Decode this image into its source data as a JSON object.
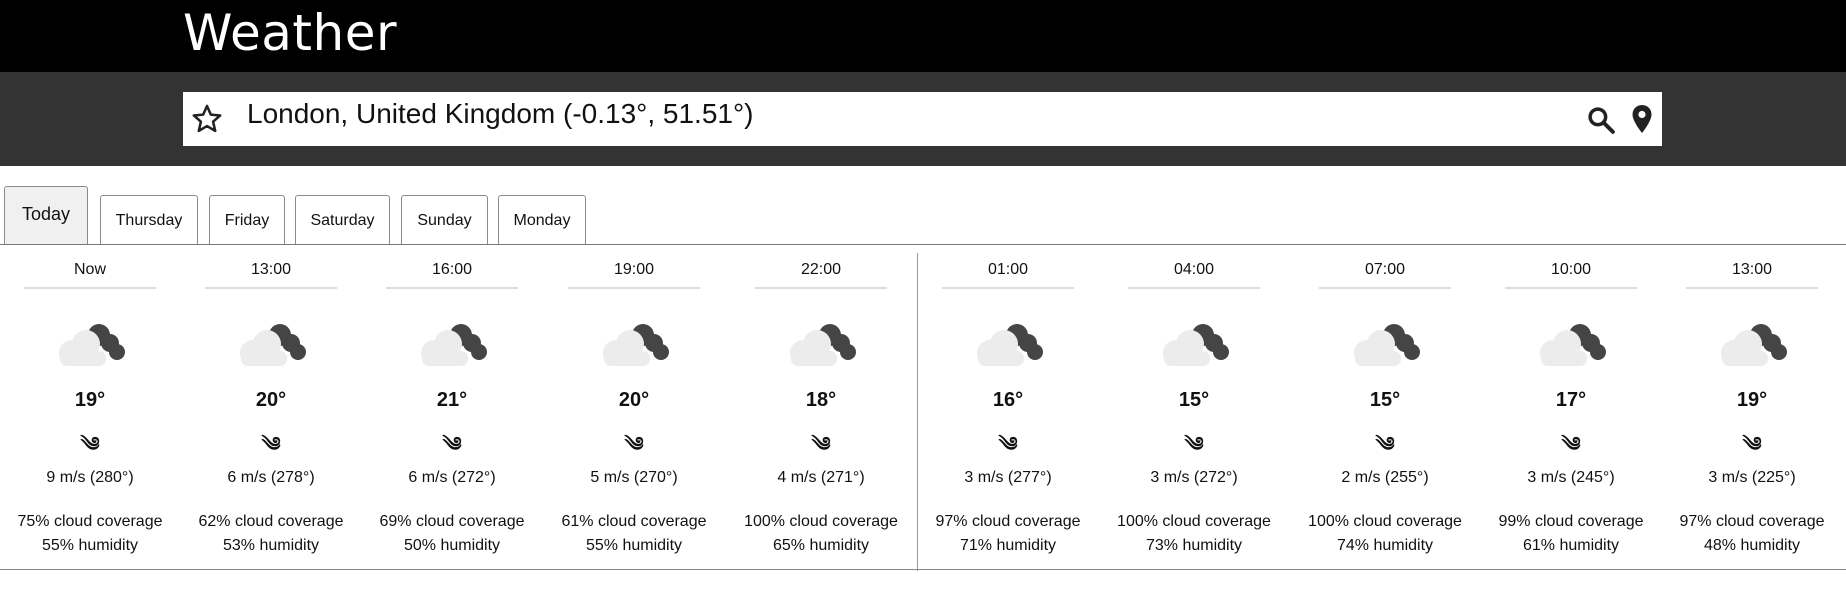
{
  "app": {
    "title": "Weather"
  },
  "search": {
    "location": "London, United Kingdom (-0.13°, 51.51°)"
  },
  "tabs": [
    {
      "label": "Today",
      "active": true
    },
    {
      "label": "Thursday",
      "active": false
    },
    {
      "label": "Friday",
      "active": false
    },
    {
      "label": "Saturday",
      "active": false
    },
    {
      "label": "Sunday",
      "active": false
    },
    {
      "label": "Monday",
      "active": false
    }
  ],
  "forecast": [
    {
      "time": "Now",
      "icon": "partly-cloudy-night-icon",
      "temp": "19°",
      "wind": "9 m/s (280°)",
      "cloud": "75% cloud coverage",
      "humidity": "55% humidity"
    },
    {
      "time": "13:00",
      "icon": "partly-cloudy-night-icon",
      "temp": "20°",
      "wind": "6 m/s (278°)",
      "cloud": "62% cloud coverage",
      "humidity": "53% humidity"
    },
    {
      "time": "16:00",
      "icon": "partly-cloudy-night-icon",
      "temp": "21°",
      "wind": "6 m/s (272°)",
      "cloud": "69% cloud coverage",
      "humidity": "50% humidity"
    },
    {
      "time": "19:00",
      "icon": "partly-cloudy-night-icon",
      "temp": "20°",
      "wind": "5 m/s (270°)",
      "cloud": "61% cloud coverage",
      "humidity": "55% humidity"
    },
    {
      "time": "22:00",
      "icon": "partly-cloudy-night-icon",
      "temp": "18°",
      "wind": "4 m/s (271°)",
      "cloud": "100% cloud coverage",
      "humidity": "65% humidity"
    },
    {
      "time": "01:00",
      "icon": "partly-cloudy-night-icon",
      "temp": "16°",
      "wind": "3 m/s (277°)",
      "cloud": "97% cloud coverage",
      "humidity": "71% humidity"
    },
    {
      "time": "04:00",
      "icon": "partly-cloudy-night-icon",
      "temp": "15°",
      "wind": "3 m/s (272°)",
      "cloud": "100% cloud coverage",
      "humidity": "73% humidity"
    },
    {
      "time": "07:00",
      "icon": "partly-cloudy-night-icon",
      "temp": "15°",
      "wind": "2 m/s (255°)",
      "cloud": "100% cloud coverage",
      "humidity": "74% humidity"
    },
    {
      "time": "10:00",
      "icon": "partly-cloudy-night-icon",
      "temp": "17°",
      "wind": "3 m/s (245°)",
      "cloud": "99% cloud coverage",
      "humidity": "61% humidity"
    },
    {
      "time": "13:00",
      "icon": "partly-cloudy-night-icon",
      "temp": "19°",
      "wind": "3 m/s (225°)",
      "cloud": "97% cloud coverage",
      "humidity": "48% humidity"
    }
  ],
  "wind_glyph": "༄"
}
